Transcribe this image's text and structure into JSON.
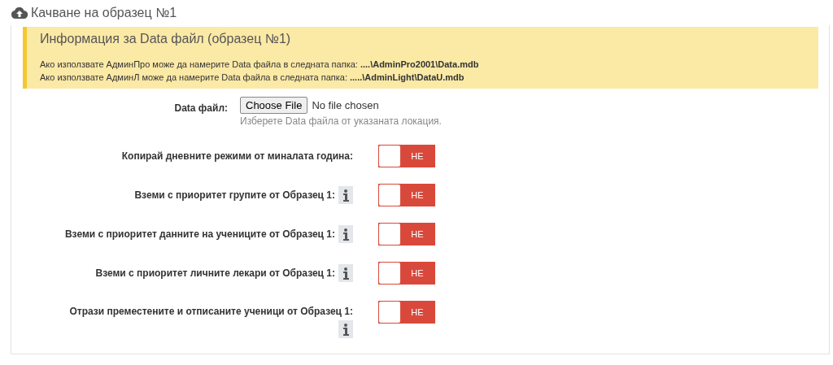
{
  "header": {
    "title": "Качване на образец №1"
  },
  "alert": {
    "title": "Информация за Data файл (образец №1)",
    "lines": [
      "Ако използвате АдминПро може да намерите Data файла в следната папка: **....\\AdminPro2001\\Data.mdb**",
      "Ако използвате АдминЛ може да намерите Data файла в следната папка: **.....\\AdminLight\\DataU.mdb**"
    ]
  },
  "file_field": {
    "label": "Data файл:",
    "button": "Choose File",
    "value": "No file chosen",
    "help": "Изберете Data файла от указаната локация."
  },
  "toggles": [
    {
      "label": "Копирай дневните режими от миналата година:",
      "kind": "plain",
      "on": false,
      "off_text": "НЕ"
    },
    {
      "label": "Вземи с приоритет групите от Образец 1:",
      "kind": "info",
      "on": false,
      "off_text": "НЕ"
    },
    {
      "label": "Вземи с приоритет данните на учениците от Образец 1:",
      "kind": "info",
      "on": false,
      "off_text": "НЕ"
    },
    {
      "label": "Вземи с приоритет личните лекари от Образец 1:",
      "kind": "info",
      "on": false,
      "off_text": "НЕ"
    },
    {
      "label": "Отрази преместените и отписаните ученици от Образец 1:",
      "kind": "wrapped",
      "on": false,
      "off_text": "НЕ"
    }
  ]
}
